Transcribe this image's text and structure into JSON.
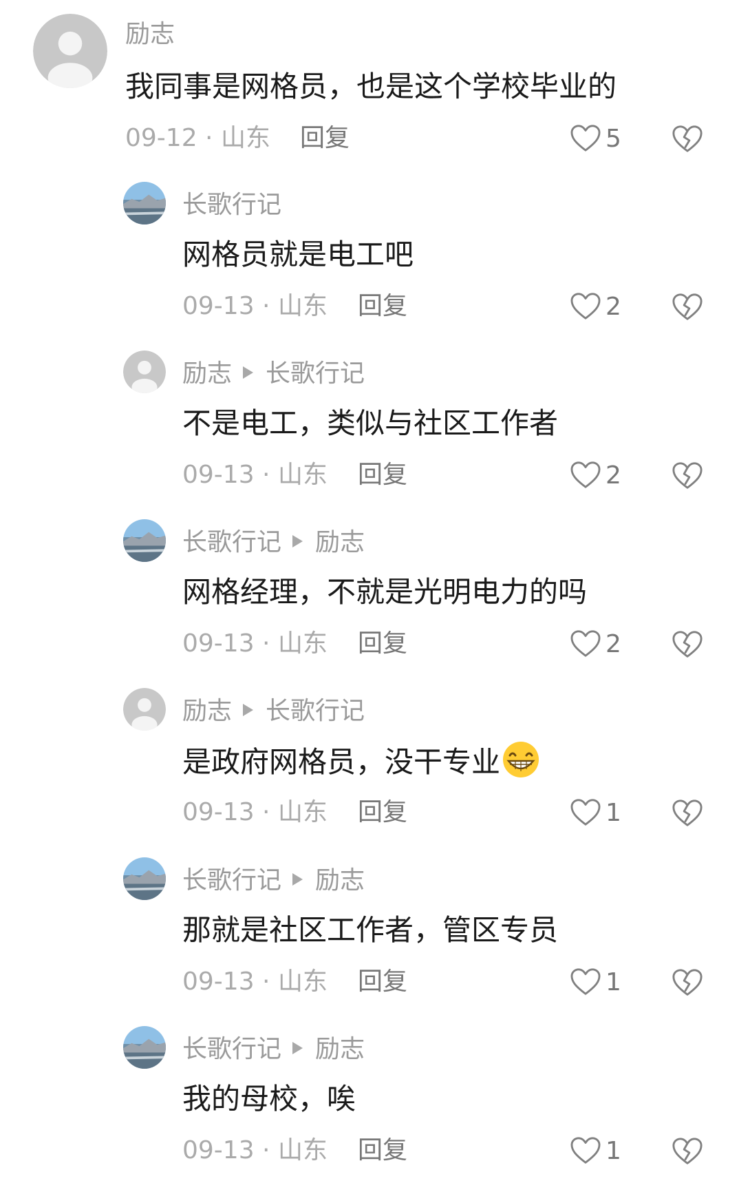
{
  "comments": [
    {
      "author": "励志",
      "reply_to": "",
      "text": "我同事是网格员，也是这个学校毕业的",
      "date": "09-12",
      "location": "山东",
      "reply_label": "回复",
      "likes": "5",
      "avatar": "default-gray-avatar",
      "level": "top"
    },
    {
      "author": "长歌行记",
      "reply_to": "",
      "text": "网格员就是电工吧",
      "date": "09-13",
      "location": "山东",
      "reply_label": "回复",
      "likes": "2",
      "avatar": "landscape-avatar",
      "level": "reply"
    },
    {
      "author": "励志",
      "reply_to": "长歌行记",
      "text": "不是电工，类似与社区工作者",
      "date": "09-13",
      "location": "山东",
      "reply_label": "回复",
      "likes": "2",
      "avatar": "default-gray-avatar",
      "level": "reply"
    },
    {
      "author": "长歌行记",
      "reply_to": "励志",
      "text": "网格经理，不就是光明电力的吗",
      "date": "09-13",
      "location": "山东",
      "reply_label": "回复",
      "likes": "2",
      "avatar": "landscape-avatar",
      "level": "reply"
    },
    {
      "author": "励志",
      "reply_to": "长歌行记",
      "text": "是政府网格员，没干专业",
      "emoji": "grinning-face-emoji",
      "date": "09-13",
      "location": "山东",
      "reply_label": "回复",
      "likes": "1",
      "avatar": "default-gray-avatar",
      "level": "reply"
    },
    {
      "author": "长歌行记",
      "reply_to": "励志",
      "text": "那就是社区工作者，管区专员",
      "date": "09-13",
      "location": "山东",
      "reply_label": "回复",
      "likes": "1",
      "avatar": "landscape-avatar",
      "level": "reply"
    },
    {
      "author": "长歌行记",
      "reply_to": "励志",
      "text": "我的母校，唉",
      "date": "09-13",
      "location": "山东",
      "reply_label": "回复",
      "likes": "1",
      "avatar": "landscape-avatar",
      "level": "reply"
    }
  ],
  "meta_separator": " · ",
  "colors": {
    "text": "#1a1a1a",
    "name": "#9a9a9a",
    "meta": "#aaaaaa",
    "icon": "#808080"
  }
}
